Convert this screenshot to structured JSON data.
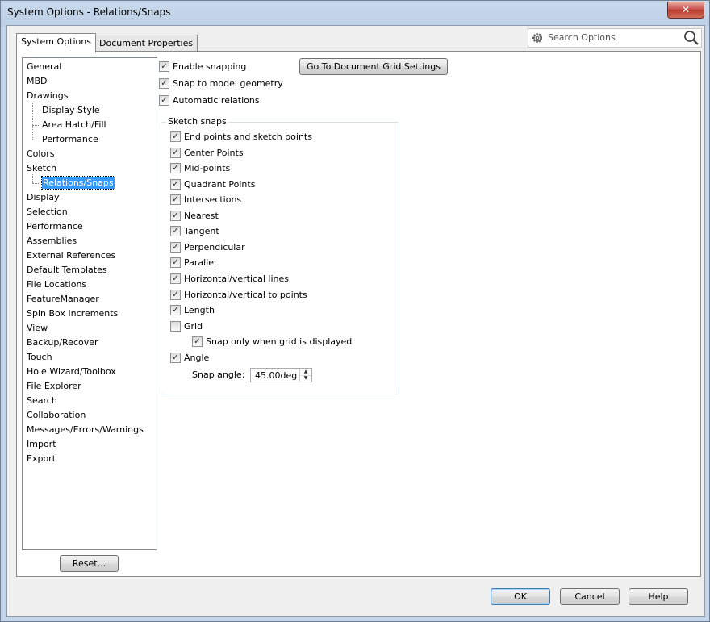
{
  "window": {
    "title": "System Options - Relations/Snaps",
    "close_label": "✕"
  },
  "tabs": [
    {
      "label": "System Options",
      "active": true
    },
    {
      "label": "Document Properties",
      "active": false
    }
  ],
  "search": {
    "placeholder": "Search Options"
  },
  "tree": {
    "items": [
      {
        "label": "General",
        "level": 0
      },
      {
        "label": "MBD",
        "level": 0
      },
      {
        "label": "Drawings",
        "level": 0
      },
      {
        "label": "Display Style",
        "level": 1
      },
      {
        "label": "Area Hatch/Fill",
        "level": 1
      },
      {
        "label": "Performance",
        "level": 1
      },
      {
        "label": "Colors",
        "level": 0
      },
      {
        "label": "Sketch",
        "level": 0
      },
      {
        "label": "Relations/Snaps",
        "level": 1,
        "selected": true
      },
      {
        "label": "Display",
        "level": 0
      },
      {
        "label": "Selection",
        "level": 0
      },
      {
        "label": "Performance",
        "level": 0
      },
      {
        "label": "Assemblies",
        "level": 0
      },
      {
        "label": "External References",
        "level": 0
      },
      {
        "label": "Default Templates",
        "level": 0
      },
      {
        "label": "File Locations",
        "level": 0
      },
      {
        "label": "FeatureManager",
        "level": 0
      },
      {
        "label": "Spin Box Increments",
        "level": 0
      },
      {
        "label": "View",
        "level": 0
      },
      {
        "label": "Backup/Recover",
        "level": 0
      },
      {
        "label": "Touch",
        "level": 0
      },
      {
        "label": "Hole Wizard/Toolbox",
        "level": 0
      },
      {
        "label": "File Explorer",
        "level": 0
      },
      {
        "label": "Search",
        "level": 0
      },
      {
        "label": "Collaboration",
        "level": 0
      },
      {
        "label": "Messages/Errors/Warnings",
        "level": 0
      },
      {
        "label": "Import",
        "level": 0
      },
      {
        "label": "Export",
        "level": 0
      }
    ]
  },
  "reset_label": "Reset...",
  "goto_grid_label": "Go To Document Grid Settings",
  "top_options": [
    {
      "label": "Enable snapping",
      "checked": true
    },
    {
      "label": "Snap to model geometry",
      "checked": true
    },
    {
      "label": "Automatic relations",
      "checked": true
    }
  ],
  "sketch_snaps": {
    "legend": "Sketch snaps",
    "items": [
      {
        "label": "End points and sketch points",
        "checked": true
      },
      {
        "label": "Center Points",
        "checked": true
      },
      {
        "label": "Mid-points",
        "checked": true
      },
      {
        "label": "Quadrant Points",
        "checked": true
      },
      {
        "label": "Intersections",
        "checked": true
      },
      {
        "label": "Nearest",
        "checked": true
      },
      {
        "label": "Tangent",
        "checked": true
      },
      {
        "label": "Perpendicular",
        "checked": true
      },
      {
        "label": "Parallel",
        "checked": true
      },
      {
        "label": "Horizontal/vertical lines",
        "checked": true
      },
      {
        "label": "Horizontal/vertical to points",
        "checked": true
      },
      {
        "label": "Length",
        "checked": true
      },
      {
        "label": "Grid",
        "checked": false
      },
      {
        "label": "Snap only when grid is displayed",
        "checked": true,
        "indent": true
      },
      {
        "label": "Angle",
        "checked": true
      }
    ],
    "snap_angle_label": "Snap angle:",
    "snap_angle_value": "45.00deg"
  },
  "footer": {
    "ok_label": "OK",
    "cancel_label": "Cancel",
    "help_label": "Help"
  },
  "check_glyph": "✓"
}
